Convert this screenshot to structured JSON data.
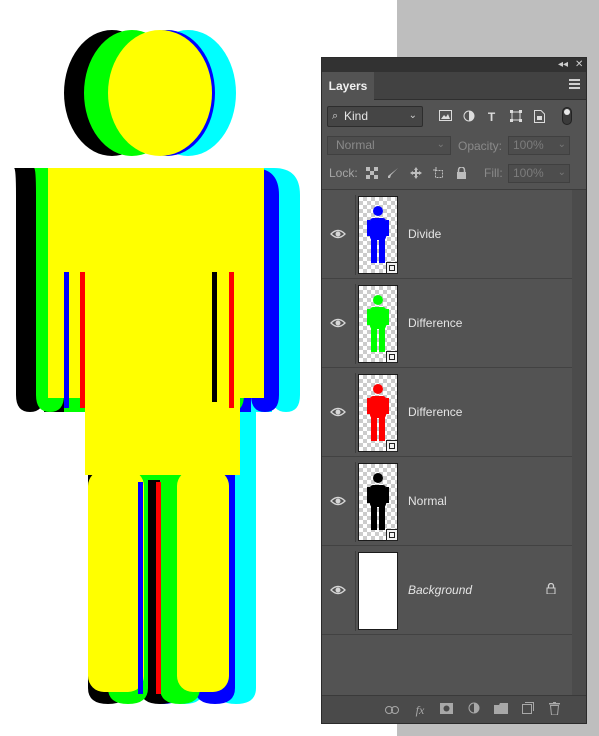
{
  "panel": {
    "tab_label": "Layers",
    "collapse_glyph": "◂◂",
    "close_glyph": "✕",
    "filter": {
      "kind_label": "Kind",
      "search_glyph": "⌕"
    },
    "blend_mode": "Normal",
    "opacity_label": "Opacity:",
    "opacity_value": "100%",
    "lock_label": "Lock:",
    "fill_label": "Fill:",
    "fill_value": "100%",
    "layers": [
      {
        "name": "Divide",
        "figure_color": "#0000ff",
        "visible": true,
        "smart_object": true
      },
      {
        "name": "Difference",
        "figure_color": "#00ff00",
        "visible": true,
        "smart_object": true
      },
      {
        "name": "Difference",
        "figure_color": "#ff0000",
        "visible": true,
        "smart_object": true
      },
      {
        "name": "Normal",
        "figure_color": "#000000",
        "visible": true,
        "smart_object": true
      },
      {
        "name": "Background",
        "figure_color": "#ffffff",
        "visible": true,
        "smart_object": false,
        "locked": true
      }
    ]
  },
  "canvas": {
    "figure_colors": [
      "#000000",
      "#00ff00",
      "#0000ff",
      "#00ffff",
      "#ff0000",
      "#ff00ff",
      "#ffff00"
    ]
  }
}
